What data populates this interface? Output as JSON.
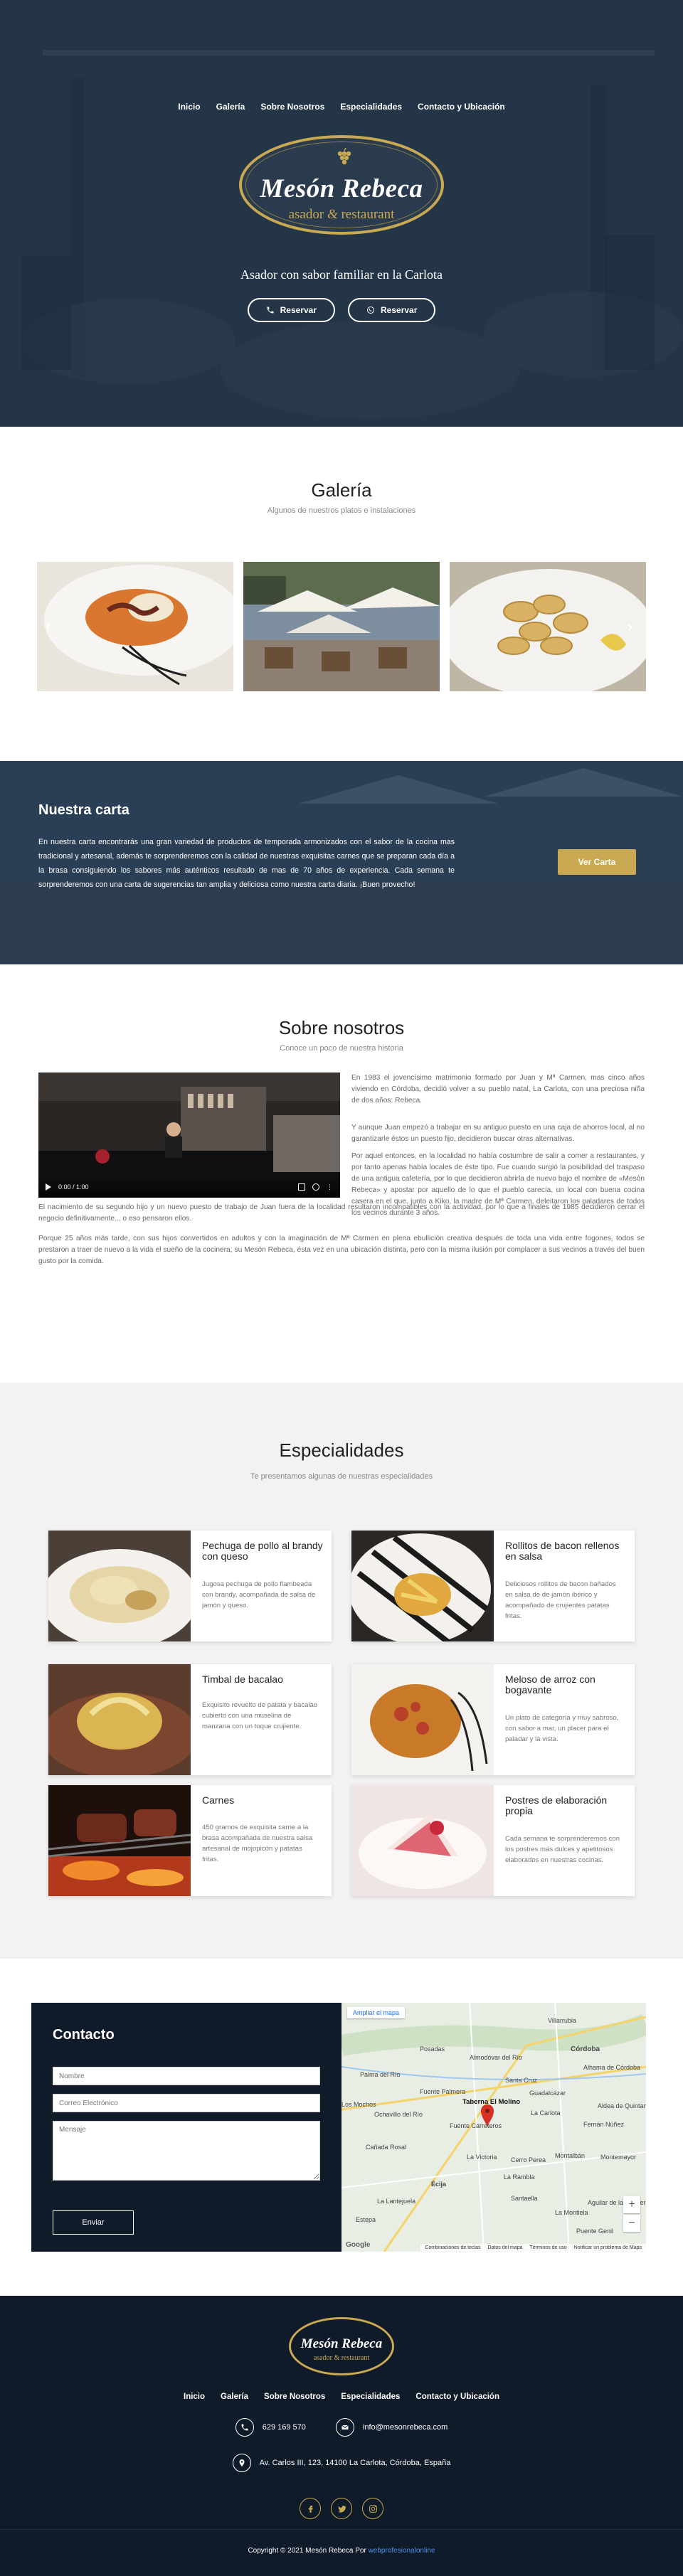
{
  "nav": {
    "items": [
      "Inicio",
      "Galería",
      "Sobre Nosotros",
      "Especialidades",
      "Contacto y Ubicación"
    ]
  },
  "hero": {
    "logo_name": "Mesón Rebeca",
    "logo_sub_left": "asador",
    "logo_amp": "&",
    "logo_sub_right": "restaurant",
    "tagline": "Asador con sabor familiar en la Carlota",
    "buttons": [
      "Reservar",
      "Reservar"
    ]
  },
  "galeria": {
    "title": "Galería",
    "subtitle": "Algunos de nuestros platos e instalaciones",
    "prev_arrow": "‹",
    "next_arrow": "›"
  },
  "carta": {
    "title": "Nuestra carta",
    "text": "En nuestra carta encontrarás una gran variedad de productos de temporada armonizados con el sabor de la cocina mas tradicional y artesanal, además te sorprenderemos con la calidad de nuestras exquisitas carnes que se preparan cada día a la brasa consiguiendo los sabores más auténticos resultado de mas de 70 años de experiencia. Cada semana te sorprenderemos con una carta de sugerencias tan amplia y deliciosa como nuestra carta diaria. ¡Buen provecho!",
    "button": "Ver Carta"
  },
  "sobre": {
    "title": "Sobre nosotros",
    "subtitle": "Conoce un poco de nuestra historia",
    "video_time": "0:00 / 1:00",
    "p1": "En 1983 el jovencísimo matrimonio formado por Juan y Mª Carmen, mas cinco años viviendo en Córdoba, decidió volver a su pueblo natal, La Carlota, con una preciosa niña de dos años: Rebeca.",
    "p2": "Y aunque Juan empezó a trabajar en su antiguo puesto en una caja de ahorros local, al no garantizarle éstos un puesto fijo, decidieron buscar otras alternativas.",
    "p3": "Por aquel entonces, en la localidad no había costumbre de salir a comer a restaurantes, y por tanto apenas había locales de éste tipo. Fue cuando surgió la posibilidad del traspaso de una antigua cafetería, por lo que decidieron abrirla de nuevo bajo el nombre de «Mesón Rebeca» y apostar por aquello de lo que el pueblo carecía, un local con buena cocina casera en el que, junto a Kiko, la madre de Mª Carmen, deleitaron los paladares de todos los vecinos durante 3 años.",
    "p4": "El nacimiento de su segundo hijo y un nuevo puesto de trabajo de Juan fuera de la localidad resultaron incompatibles con la actividad, por lo que a finales de 1985 decidieron cerrar el negocio definitivamente... o eso pensaron ellos.",
    "p5": "Porque 25 años más tarde, con sus hijos convertidos en adultos y con la imaginación de Mª Carmen en plena ebullición creativa después de toda una vida entre fogones, todos se prestaron a traer de nuevo a la vida el sueño de la cocinera; su Mesón Rebeca, ésta vez en una ubicación distinta, pero con la misma ilusión por complacer a sus vecinos a través del buen gusto por la comida."
  },
  "especialidades": {
    "title": "Especialidades",
    "subtitle": "Te presentamos algunas de nuestras especialidades",
    "cards": [
      {
        "title": "Pechuga de pollo al brandy con queso",
        "desc": "Jugosa pechuga de pollo flambeada con brandy, acompañada de salsa de jamón y queso."
      },
      {
        "title": "Rollitos de bacon rellenos en salsa",
        "desc": "Deliciosos rollitos de bacon bañados en salsa de de jamón ibérico y acompañado de crujientes patatas fritas."
      },
      {
        "title": "Timbal de bacalao",
        "desc": "Exquisito revuelto de patata y bacalao cubierto con una muselina de manzana con un toque crujiente."
      },
      {
        "title": "Meloso de arroz con bogavante",
        "desc": "Un plato de categoría y muy sabroso, con sabor a mar, un placer para el paladar y la vista."
      },
      {
        "title": "Carnes",
        "desc": "450 gramos de exquisita carne a la brasa acompañada de nuestra salsa artesanal de mojopicón y patatas fritas."
      },
      {
        "title": "Postres de elaboración propia",
        "desc": "Cada semana te sorprenderemos con los postres más dulces y apetitosos elaborados en nuestras cocinas."
      }
    ]
  },
  "contacto": {
    "title": "Contacto",
    "name_placeholder": "Nombre",
    "email_placeholder": "Correo Electrónico",
    "message_placeholder": "Mensaje",
    "send_button": "Enviar",
    "map": {
      "expand": "Ampliar el mapa",
      "marker_label": "Taberna El Molino",
      "places": [
        "Córdoba",
        "Villarrubia",
        "Almodóvar del Río",
        "Santa Cruz",
        "Écija",
        "La Carlota",
        "Guadalcázar",
        "Fuente Palmera",
        "Posadas",
        "Palma del Río",
        "Cañada Rosal",
        "La Victoria",
        "Cerro Perea",
        "Fernán Núñez",
        "Montalbán",
        "Montemayor",
        "Aguilar de la Frontera",
        "La Rambla",
        "Fuente Carreteros",
        "Puente Genil",
        "Santaella",
        "La Lantejuela",
        "Los Mochos",
        "Estepa",
        "La Montiela",
        "Alhama de Córdoba",
        "Ochavillo del Río",
        "Aldea de Quintana"
      ],
      "attribution": [
        "Combinaciones de teclas",
        "Datos del mapa",
        "Términos de uso",
        "Notificar un problema de Maps"
      ],
      "zoom_in": "+",
      "zoom_out": "−",
      "google": "Google"
    }
  },
  "footer": {
    "logo_name": "Mesón Rebeca",
    "logo_sub": "asador & restaurant",
    "phone": "629 169 570",
    "email": "info@mesonrebeca.com",
    "address": "Av. Carlos III, 123, 14100 La Carlota, Córdoba, España",
    "copyright": "Copyright © 2021 Mesón Rebeca Por",
    "copyright_link": "webprofesionalonline"
  },
  "colors": {
    "gold": "#c9a951",
    "navy": "#101b2a",
    "hero_overlay": "#1e2d41"
  }
}
